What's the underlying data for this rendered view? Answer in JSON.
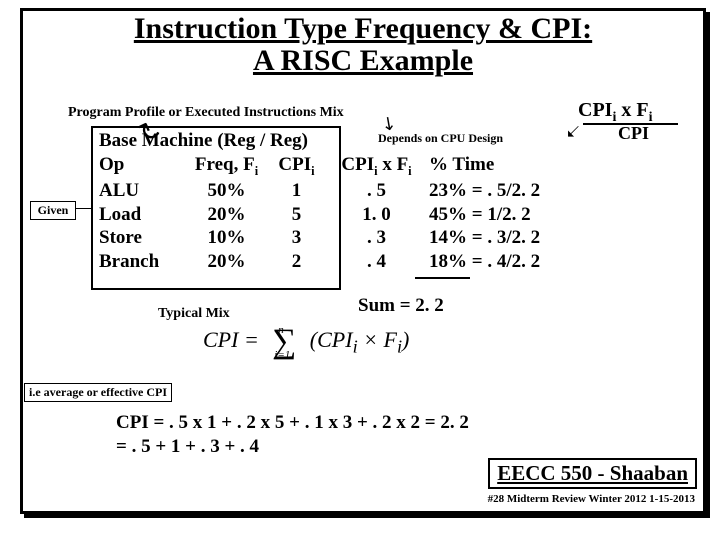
{
  "title_line1": "Instruction Type Frequency & CPI:",
  "title_line2": "A RISC Example",
  "program_profile": "Program Profile or Executed Instructions Mix",
  "top_frac_num": "CPIi x Fi",
  "top_frac_den": "CPI",
  "depends": "Depends on CPU Design",
  "given_label": "Given",
  "base_machine": "Base Machine (Reg / Reg)",
  "hdr": {
    "op": "Op",
    "freq": "Freq, Fi",
    "cpi": "CPIi",
    "cxf": "CPIi x Fi",
    "pct": "% Time"
  },
  "rows": [
    {
      "op": "ALU",
      "freq": "50%",
      "cpi": "1",
      "cxf": ". 5",
      "pct": "23% =  . 5/2. 2"
    },
    {
      "op": "Load",
      "freq": "20%",
      "cpi": "5",
      "cxf": "1. 0",
      "pct": "45% =  1/2. 2"
    },
    {
      "op": "Store",
      "freq": "10%",
      "cpi": "3",
      "cxf": ". 3",
      "pct": "14% =  . 3/2. 2"
    },
    {
      "op": "Branch",
      "freq": "20%",
      "cpi": "2",
      "cxf": ". 4",
      "pct": "18% =  . 4/2. 2"
    }
  ],
  "sum": "Sum  =  2. 2",
  "typical_mix": "Typical Mix",
  "formula_lhs": "CPI = ",
  "formula_inside": "(CPIi × Fi)",
  "formula_top": "n",
  "formula_bot": "i=1",
  "ie_label": "i.e average or effective CPI",
  "calc_line1": "CPI   =  . 5 x 1 +  . 2 x 5  + . 1 x 3 +  . 2 x 2  = 2. 2",
  "calc_line2": "        =   . 5    +      1    +   . 3    +   . 4",
  "course": "EECC 550 - Shaaban",
  "footer": "#28   Midterm  Review   Winter  2012  1-15-2013",
  "chart_data": {
    "type": "table",
    "title": "Base Machine (Reg / Reg)",
    "columns": [
      "Op",
      "Freq Fi",
      "CPIi",
      "CPIi x Fi",
      "% Time"
    ],
    "rows": [
      [
        "ALU",
        0.5,
        1,
        0.5,
        0.23
      ],
      [
        "Load",
        0.2,
        5,
        1.0,
        0.45
      ],
      [
        "Store",
        0.1,
        3,
        0.3,
        0.14
      ],
      [
        "Branch",
        0.2,
        2,
        0.4,
        0.18
      ]
    ],
    "sum_cpixfi": 2.2,
    "effective_cpi": 2.2
  }
}
